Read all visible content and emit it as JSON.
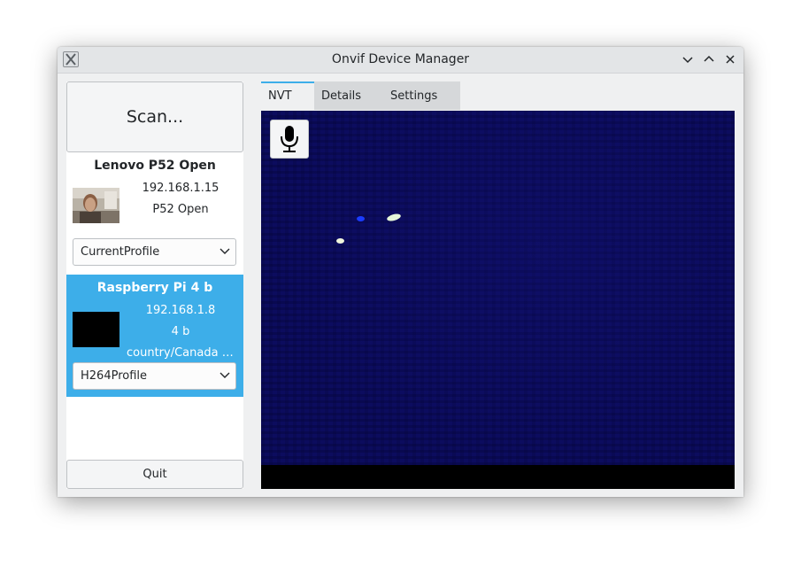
{
  "window": {
    "title": "Onvif Device Manager"
  },
  "left": {
    "scan_label": "Scan...",
    "quit_label": "Quit",
    "devices": [
      {
        "name": "Lenovo P52 Open",
        "ip": "192.168.1.15",
        "model": "P52 Open",
        "profile": "CurrentProfile",
        "thumbnail": "webcam-person-photo"
      },
      {
        "name": "Raspberry Pi 4 b",
        "ip": "192.168.1.8",
        "model": "4 b",
        "location": "country/Canada c...",
        "profile": "H264Profile",
        "thumbnail": "black-frame",
        "selected": true
      }
    ]
  },
  "tabs": [
    {
      "label": "NVT",
      "active": true
    },
    {
      "label": "Details",
      "active": false
    },
    {
      "label": "Settings",
      "active": false
    }
  ],
  "video": {
    "mic_icon": "microphone-icon"
  },
  "colors": {
    "accent": "#3daee9",
    "window_bg": "#eff0f1",
    "video_bg": "#0c0c5e"
  }
}
